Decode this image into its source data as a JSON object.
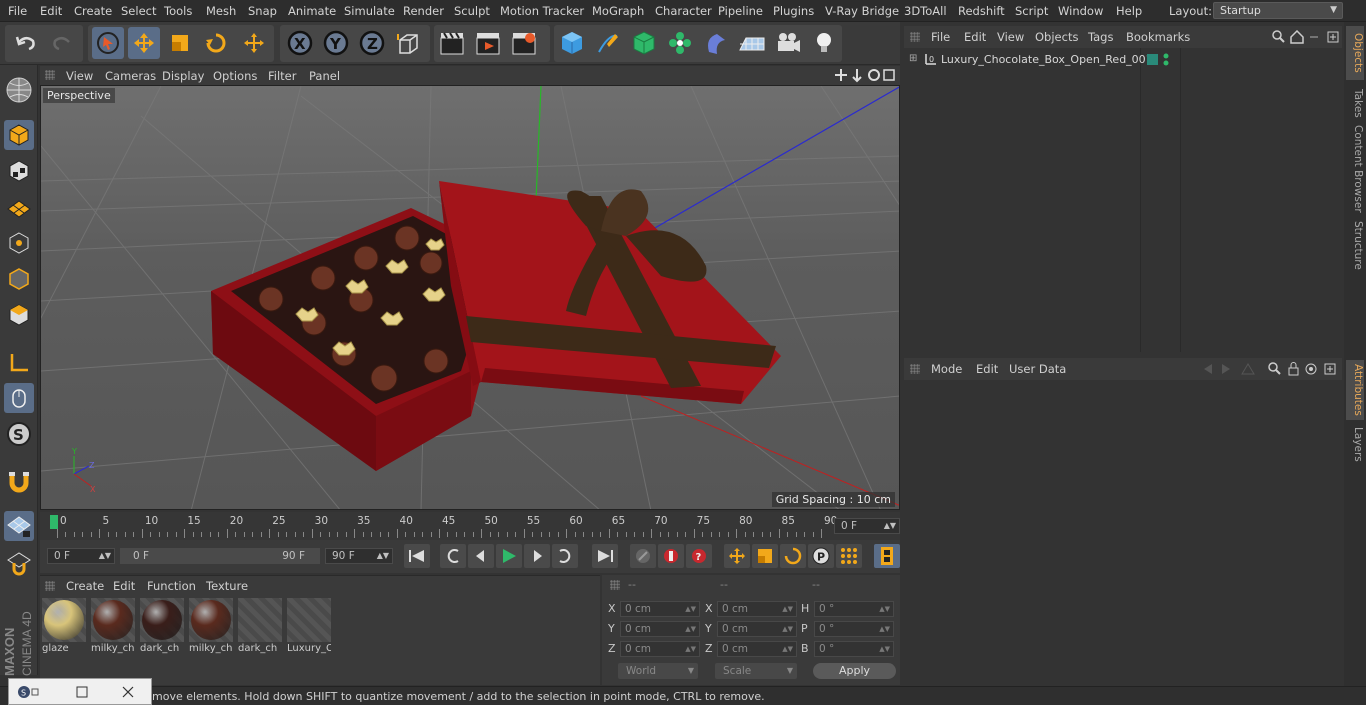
{
  "menubar": {
    "items": [
      "File",
      "Edit",
      "Create",
      "Select",
      "Tools",
      "Mesh",
      "Snap",
      "Animate",
      "Simulate",
      "Render",
      "Sculpt",
      "Motion Tracker",
      "MoGraph",
      "Character",
      "Pipeline",
      "Plugins",
      "V-Ray Bridge",
      "3DToAll",
      "Redshift",
      "Script",
      "Window",
      "Help"
    ],
    "layout_label": "Layout:",
    "layout_value": "Startup"
  },
  "viewport": {
    "menu": [
      "View",
      "Cameras",
      "Display",
      "Options",
      "Filter",
      "Panel"
    ],
    "label": "Perspective",
    "grid_spacing": "Grid Spacing : 10 cm"
  },
  "timeline": {
    "ticks": [
      "0",
      "5",
      "10",
      "15",
      "20",
      "25",
      "30",
      "35",
      "40",
      "45",
      "50",
      "55",
      "60",
      "65",
      "70",
      "75",
      "80",
      "85",
      "90"
    ],
    "current_frame": "0 F"
  },
  "transport": {
    "start_field": "0 F",
    "range_start": "0 F",
    "range_end": "90 F",
    "end_field": "90 F"
  },
  "materials": {
    "menu": [
      "Create",
      "Edit",
      "Function",
      "Texture"
    ],
    "items": [
      {
        "name": "glaze",
        "color": "#d8c47a"
      },
      {
        "name": "milky_ch",
        "color": "#5a2a1e"
      },
      {
        "name": "dark_ch",
        "color": "#3a1e1a"
      },
      {
        "name": "milky_ch",
        "color": "#5a2a1e"
      },
      {
        "name": "dark_ch",
        "color": ""
      },
      {
        "name": "Luxury_C",
        "color": ""
      }
    ]
  },
  "coords": {
    "headers": [
      "--",
      "--",
      "--"
    ],
    "rows": [
      {
        "a": "X",
        "av": "0 cm",
        "b": "X",
        "bv": "0 cm",
        "c": "H",
        "cv": "0 °"
      },
      {
        "a": "Y",
        "av": "0 cm",
        "b": "Y",
        "bv": "0 cm",
        "c": "P",
        "cv": "0 °"
      },
      {
        "a": "Z",
        "av": "0 cm",
        "b": "Z",
        "bv": "0 cm",
        "c": "B",
        "cv": "0 °"
      }
    ],
    "world": "World",
    "scale": "Scale",
    "apply": "Apply"
  },
  "objects": {
    "menu": [
      "File",
      "Edit",
      "View",
      "Objects",
      "Tags",
      "Bookmarks"
    ],
    "item": "Luxury_Chocolate_Box_Open_Red_001"
  },
  "attributes": {
    "menu": [
      "Mode",
      "Edit",
      "User Data"
    ]
  },
  "right_tabs": [
    "Objects",
    "Takes",
    "Content Browser",
    "Structure",
    "Attributes",
    "Layers"
  ],
  "status": "move elements. Hold down SHIFT to quantize movement / add to the selection in point mode, CTRL to remove.",
  "brand": {
    "maxon": "MAXON",
    "product": "CINEMA 4D"
  },
  "colors": {
    "accent": "#5a6d88",
    "box_red": "#a3141a",
    "ribbon": "#3d2a18"
  }
}
